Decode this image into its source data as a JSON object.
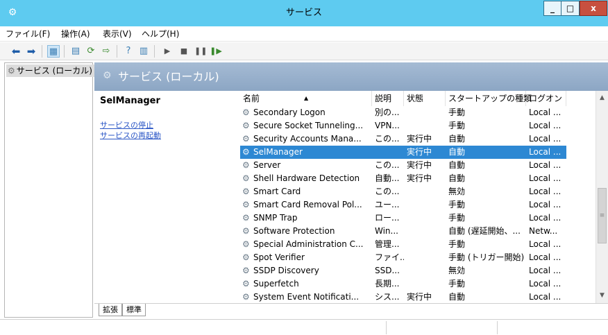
{
  "window": {
    "title": "サービス"
  },
  "menu": [
    "ファイル(F)",
    "操作(A)",
    "表示(V)",
    "ヘルプ(H)"
  ],
  "tree": {
    "root_label": "サービス (ローカル)"
  },
  "pane": {
    "title": "サービス (ローカル)"
  },
  "details": {
    "selected_service": "SelManager",
    "links": [
      "サービスの停止",
      "サービスの再起動"
    ]
  },
  "columns": [
    "名前",
    "説明",
    "状態",
    "スタートアップの種類",
    "ログオン"
  ],
  "rows": [
    {
      "name": "Secondary Logon",
      "desc": "別の...",
      "status": "",
      "startup": "手動",
      "logon": "Local ..."
    },
    {
      "name": "Secure Socket Tunneling...",
      "desc": "VPN...",
      "status": "",
      "startup": "手動",
      "logon": "Local ..."
    },
    {
      "name": "Security Accounts Mana...",
      "desc": "この...",
      "status": "実行中",
      "startup": "自動",
      "logon": "Local ..."
    },
    {
      "name": "SelManager",
      "desc": "",
      "status": "実行中",
      "startup": "自動",
      "logon": "Local ..."
    },
    {
      "name": "Server",
      "desc": "この...",
      "status": "実行中",
      "startup": "自動",
      "logon": "Local ..."
    },
    {
      "name": "Shell Hardware Detection",
      "desc": "自動...",
      "status": "実行中",
      "startup": "自動",
      "logon": "Local ..."
    },
    {
      "name": "Smart Card",
      "desc": "この...",
      "status": "",
      "startup": "無効",
      "logon": "Local ..."
    },
    {
      "name": "Smart Card Removal Pol...",
      "desc": "ユー...",
      "status": "",
      "startup": "手動",
      "logon": "Local ..."
    },
    {
      "name": "SNMP Trap",
      "desc": "ロー...",
      "status": "",
      "startup": "手動",
      "logon": "Local ..."
    },
    {
      "name": "Software Protection",
      "desc": "Win...",
      "status": "",
      "startup": "自動 (遅延開始、...",
      "logon": "Netw..."
    },
    {
      "name": "Special Administration C...",
      "desc": "管理...",
      "status": "",
      "startup": "手動",
      "logon": "Local ..."
    },
    {
      "name": "Spot Verifier",
      "desc": "ファイ...",
      "status": "",
      "startup": "手動 (トリガー開始)",
      "logon": "Local ..."
    },
    {
      "name": "SSDP Discovery",
      "desc": "SSD...",
      "status": "",
      "startup": "無効",
      "logon": "Local ..."
    },
    {
      "name": "Superfetch",
      "desc": "長期...",
      "status": "",
      "startup": "手動",
      "logon": "Local ..."
    },
    {
      "name": "System Event Notificati...",
      "desc": "シス...",
      "status": "実行中",
      "startup": "自動",
      "logon": "Local ..."
    }
  ],
  "tabs": [
    "拡張",
    "標準"
  ]
}
